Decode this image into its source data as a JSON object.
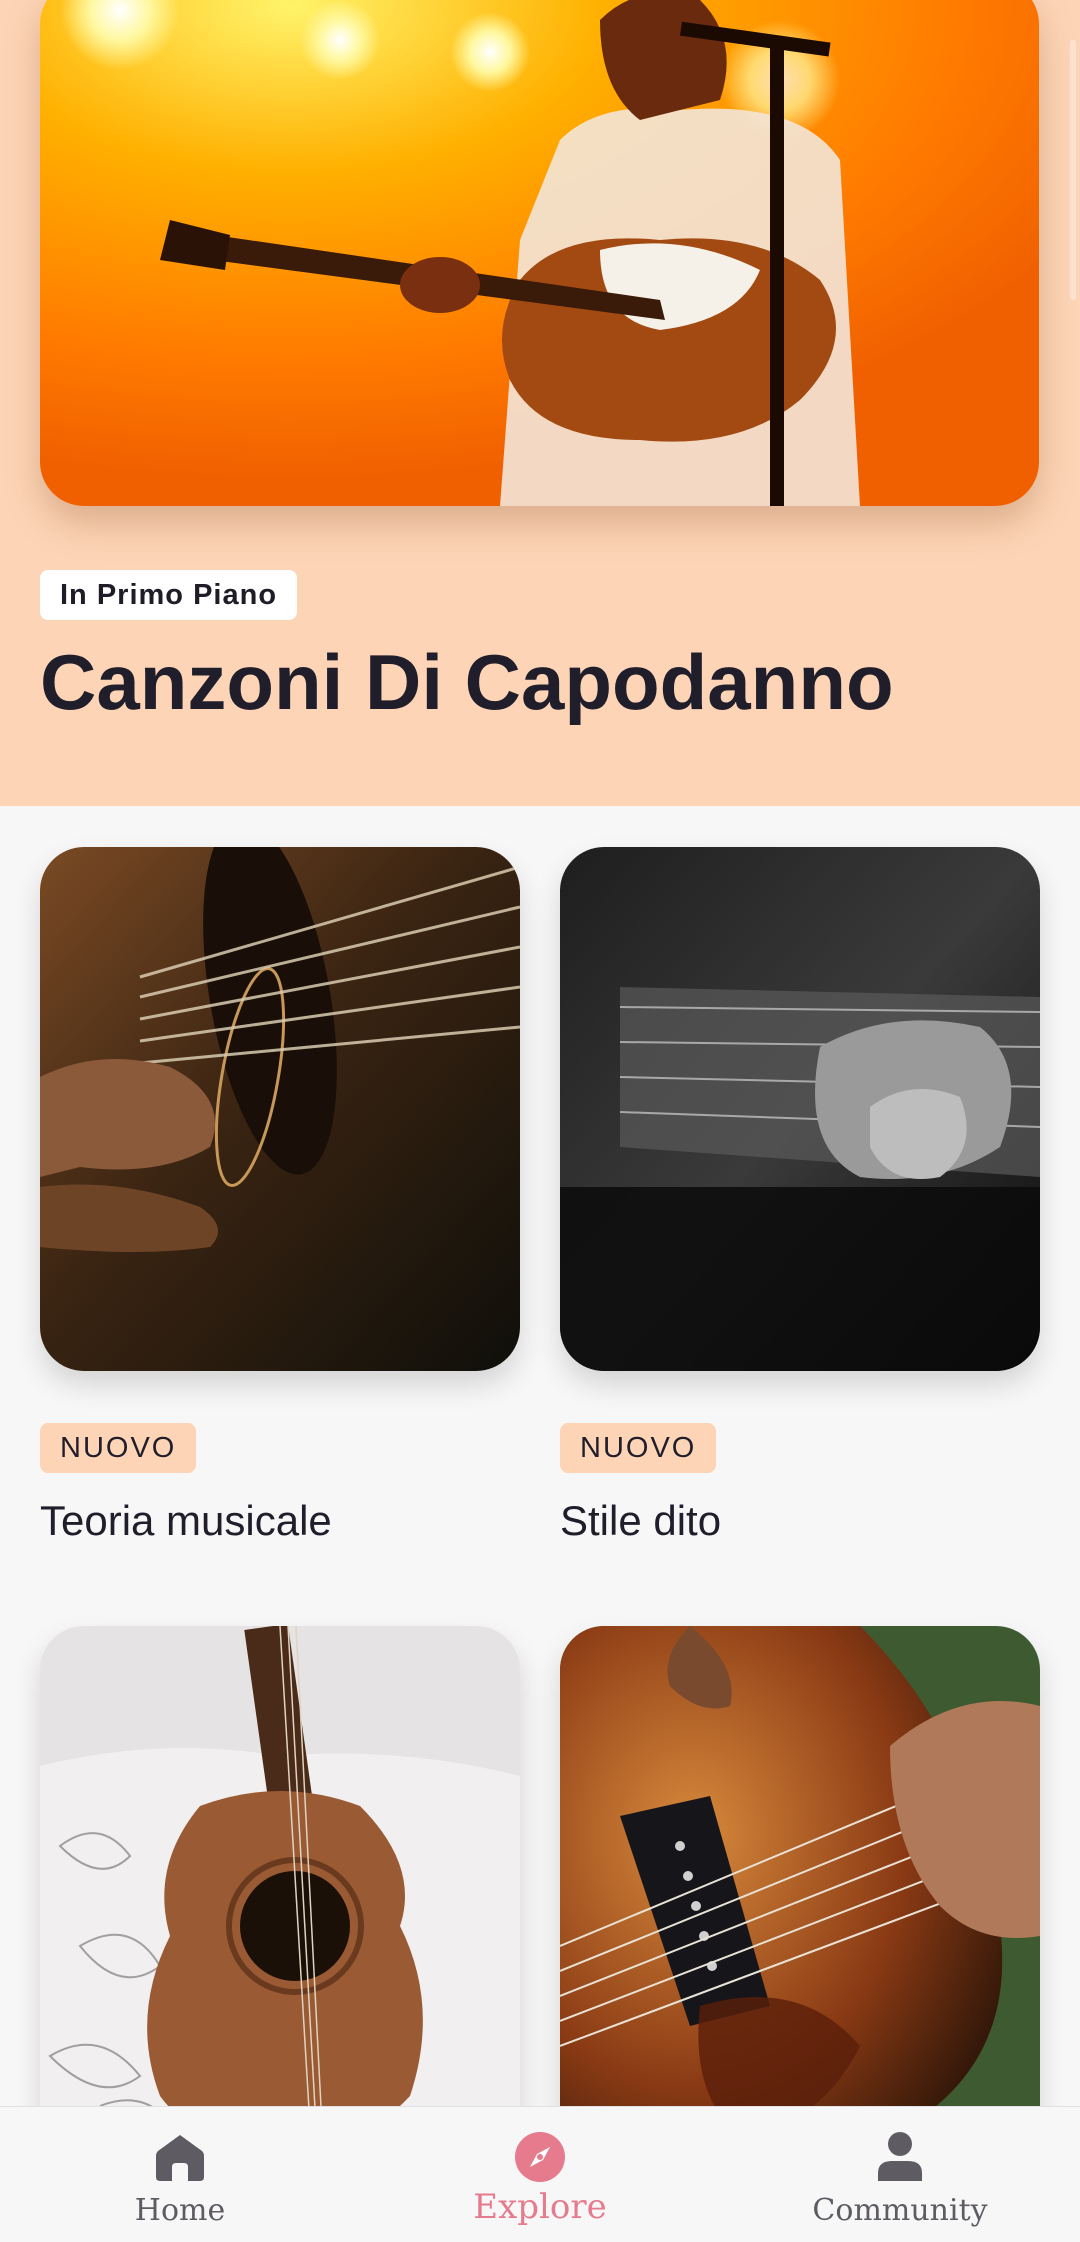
{
  "featured": {
    "badge": "In Primo Piano",
    "title": "Canzoni Di Capodanno",
    "image": "concert-guitarist-photo"
  },
  "cards": [
    {
      "badge": "NUOVO",
      "title": "Teoria musicale",
      "image": "acoustic-guitar-closeup-photo"
    },
    {
      "badge": "NUOVO",
      "title": "Stile dito",
      "image": "fingerstyle-bw-photo"
    },
    {
      "image": "acoustic-guitar-on-pillow-photo"
    },
    {
      "image": "electric-guitar-hands-photo"
    }
  ],
  "nav": {
    "items": [
      {
        "label": "Home",
        "icon": "home-icon"
      },
      {
        "label": "Explore",
        "icon": "compass-icon"
      },
      {
        "label": "Community",
        "icon": "person-icon"
      }
    ],
    "active_color": "#e57b8d",
    "inactive_color": "#5f5b63"
  },
  "colors": {
    "featured_bg": "#fdd5b6",
    "badge_bg": "#fdd5b6",
    "page_bg": "#f8f7f8"
  }
}
